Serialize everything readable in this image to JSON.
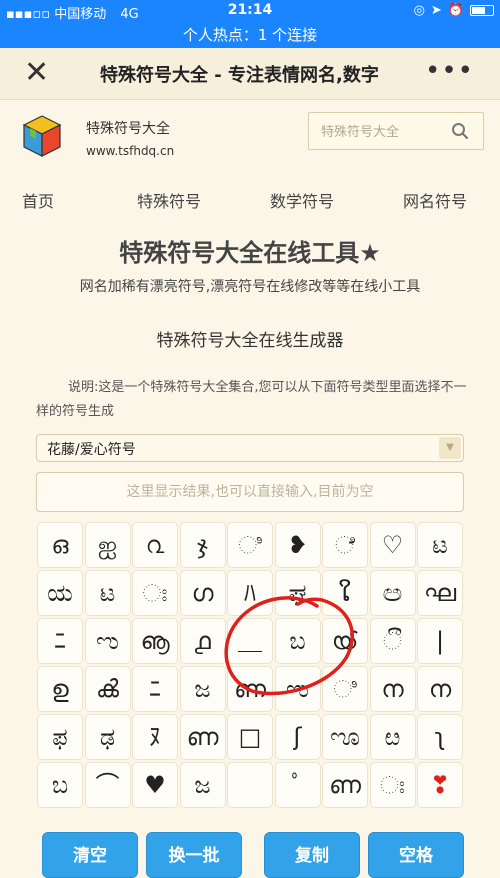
{
  "status_bar": {
    "carrier": "中国移动",
    "network": "4G",
    "time": "21:14"
  },
  "hotspot": "个人热点：1 个连接",
  "nav": {
    "title": "特殊符号大全 - 专注表情网名,数字"
  },
  "header": {
    "site_name": "特殊符号大全",
    "site_url": "www.tsfhdq.cn",
    "search_placeholder": "特殊符号大全"
  },
  "menu": [
    "首页",
    "特殊符号",
    "数学符号",
    "网名符号"
  ],
  "main_title": "特殊符号大全在线工具★",
  "subtitle": "网名加稀有漂亮符号,漂亮符号在线修改等等在线小工具",
  "generator_title": "特殊符号大全在线生成器",
  "description": "说明:这是一个特殊符号大全集合,您可以从下面符号类型里面选择不一样的符号生成",
  "type_select": "花藤/爱心符号",
  "result_placeholder": "这里显示结果,也可以直接输入,目前为空",
  "symbols": [
    [
      "ഒ",
      "ஐ",
      "൨",
      "ჯ",
      "ಿ",
      "❥",
      "ೆ",
      "♡",
      "ಟ"
    ],
    [
      "ಯ",
      "ಟ",
      "ಃ",
      "ഗ",
      "ﾊ",
      "ಘ",
      "ໃ",
      "ඏ",
      "ഘ"
    ],
    [
      "ﾆ",
      "ಌ",
      "ൡ",
      "൧",
      "＿",
      "ಬ",
      "ൕ",
      "ී",
      "|"
    ],
    [
      "ഉ",
      "ൿ",
      "ﾆ",
      "ಜ",
      "ണ",
      "ಌ",
      "ಿ",
      "ന",
      "ന"
    ],
    [
      "ಫ",
      "ಢ",
      "ﾇ",
      "ണ",
      "□",
      "ʃ",
      "ೡ",
      "ೞ",
      "ʅ"
    ],
    [
      "ಬ",
      "⌒",
      "♥",
      "ಜ",
      "",
      "ﾟ",
      "ണ",
      "ಃ",
      "❣"
    ]
  ],
  "buttons": {
    "clear": "清空",
    "shuffle": "换一批",
    "copy": "复制",
    "space": "空格"
  },
  "colors": {
    "status_bar": "#1b84ff",
    "button": "#32a3e8",
    "background": "#fbf6e8"
  }
}
